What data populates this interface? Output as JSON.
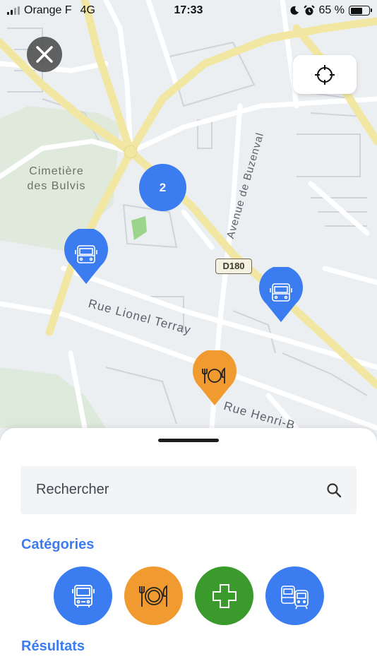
{
  "status_bar": {
    "carrier": "Orange F",
    "network": "4G",
    "time": "17:33",
    "battery_text": "65 %",
    "battery_level": 0.65
  },
  "map": {
    "labels": {
      "cemetery_line1": "Cimetière",
      "cemetery_line2": "des Bulvis",
      "street_lionel": "Rue Lionel Terray",
      "street_henri": "Rue Henri-B",
      "avenue_buzenval": "Avenue de Buzenval",
      "road_badge": "D180"
    },
    "cluster_count": "2",
    "markers": [
      {
        "type": "bus",
        "icon": "bus-icon",
        "color": "#3b7cf0"
      },
      {
        "type": "bus",
        "icon": "bus-icon",
        "color": "#3b7cf0"
      },
      {
        "type": "food",
        "icon": "restaurant-icon",
        "color": "#f09a30"
      }
    ]
  },
  "sheet": {
    "search": {
      "placeholder": "Rechercher"
    },
    "categories_title": "Catégories",
    "results_title": "Résultats",
    "categories": [
      {
        "name": "bus",
        "icon": "bus-icon",
        "color": "#3b7cf0"
      },
      {
        "name": "restaurant",
        "icon": "restaurant-icon",
        "color": "#f09a30"
      },
      {
        "name": "pharmacy",
        "icon": "cross-icon",
        "color": "#3a9a2c"
      },
      {
        "name": "transit",
        "icon": "train-icon",
        "color": "#3b7cf0"
      }
    ]
  },
  "colors": {
    "accent": "#3b7cf0",
    "orange": "#f09a30",
    "green": "#3a9a2c",
    "main_road": "#f2e7a2"
  }
}
